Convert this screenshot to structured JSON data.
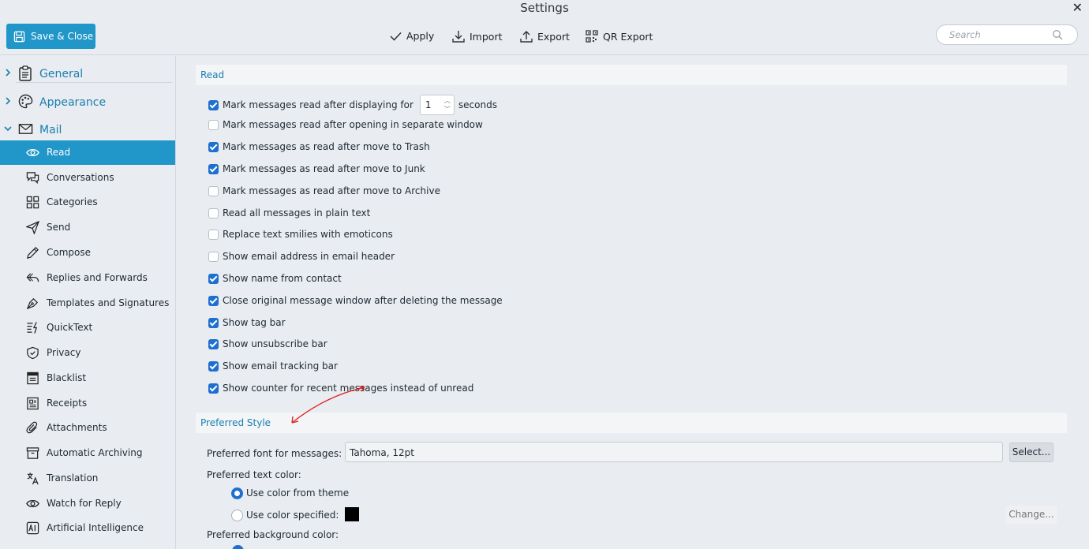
{
  "window": {
    "title": "Settings"
  },
  "toolbar": {
    "save_label": "Save & Close",
    "apply_label": "Apply",
    "import_label": "Import",
    "export_label": "Export",
    "qr_export_label": "QR Export",
    "search_placeholder": "Search"
  },
  "sidebar": {
    "sections": [
      {
        "label": "General",
        "icon": "clipboard-icon",
        "expanded": false
      },
      {
        "label": "Appearance",
        "icon": "palette-icon",
        "expanded": false
      },
      {
        "label": "Mail",
        "icon": "envelope-icon",
        "expanded": true
      }
    ],
    "items": [
      {
        "label": "Read",
        "icon": "eye-icon",
        "active": true
      },
      {
        "label": "Conversations",
        "icon": "chat-icon"
      },
      {
        "label": "Categories",
        "icon": "grid-icon"
      },
      {
        "label": "Send",
        "icon": "paper-plane-icon"
      },
      {
        "label": "Compose",
        "icon": "pencil-icon"
      },
      {
        "label": "Replies and Forwards",
        "icon": "reply-icon"
      },
      {
        "label": "Templates and Signatures",
        "icon": "pen-nib-icon"
      },
      {
        "label": "QuickText",
        "icon": "quicktext-icon"
      },
      {
        "label": "Privacy",
        "icon": "shield-icon"
      },
      {
        "label": "Blacklist",
        "icon": "blacklist-icon"
      },
      {
        "label": "Receipts",
        "icon": "receipt-icon"
      },
      {
        "label": "Attachments",
        "icon": "paperclip-icon"
      },
      {
        "label": "Automatic Archiving",
        "icon": "archive-icon"
      },
      {
        "label": "Translation",
        "icon": "translate-icon"
      },
      {
        "label": "Watch for Reply",
        "icon": "eye-icon"
      },
      {
        "label": "Artificial Intelligence",
        "icon": "ai-icon"
      }
    ]
  },
  "read": {
    "header": "Read",
    "mark_after_prefix": "Mark messages read after displaying for",
    "mark_after_seconds": "1",
    "mark_after_suffix": "seconds",
    "mark_after_checked": true,
    "options": [
      {
        "label": "Mark messages read after opening in separate window",
        "checked": false
      },
      {
        "label": "Mark messages as read after move to Trash",
        "checked": true
      },
      {
        "label": "Mark messages as read after move to Junk",
        "checked": true
      },
      {
        "label": "Mark messages as read after move to Archive",
        "checked": false
      },
      {
        "label": "Read all messages in plain text",
        "checked": false
      },
      {
        "label": "Replace text smilies with emoticons",
        "checked": false
      },
      {
        "label": "Show email address in email header",
        "checked": false
      },
      {
        "label": "Show name from contact",
        "checked": true
      },
      {
        "label": "Close original message window after deleting the message",
        "checked": true
      },
      {
        "label": "Show tag bar",
        "checked": true
      },
      {
        "label": "Show unsubscribe bar",
        "checked": true
      },
      {
        "label": "Show email tracking bar",
        "checked": true
      },
      {
        "label": "Show counter for recent messages instead of unread",
        "checked": true
      }
    ]
  },
  "preferred_style": {
    "header": "Preferred Style",
    "font_label": "Preferred font for messages:",
    "font_value": "Tahoma, 12pt",
    "select_label": "Select...",
    "text_color_label": "Preferred text color:",
    "use_theme_label": "Use color from theme",
    "use_theme_selected": true,
    "use_specified_label": "Use color specified:",
    "specified_color": "#000000",
    "change_label": "Change...",
    "background_color_label": "Preferred background color:"
  },
  "colors": {
    "accent": "#2196c9",
    "checkbox": "#1e6fd0",
    "section_text": "#1a7fb0",
    "annotation_arrow": "#e02020"
  }
}
